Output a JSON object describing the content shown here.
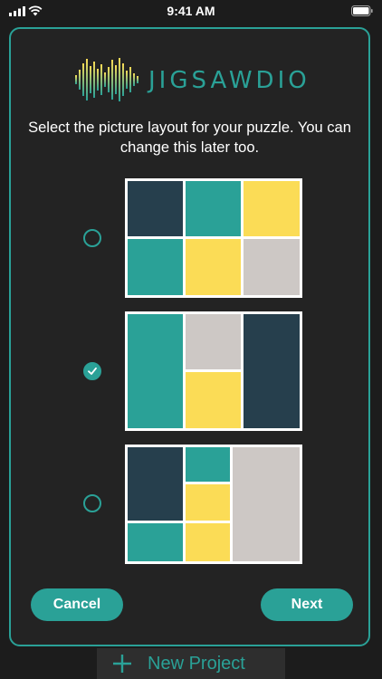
{
  "status_bar": {
    "time": "9:41 AM"
  },
  "app": {
    "logo_text": "JIGSAWDIO"
  },
  "dialog": {
    "instructions": "Select the picture layout for your puzzle.  You can change this later too.",
    "selected_option": 2,
    "cancel_label": "Cancel",
    "next_label": "Next"
  },
  "background": {
    "new_project_label": "New Project"
  },
  "colors": {
    "accent": "#2aa197",
    "navy": "#263f4d",
    "teal": "#2aa197",
    "yellow": "#fbdc56",
    "gray": "#cdc8c5"
  }
}
